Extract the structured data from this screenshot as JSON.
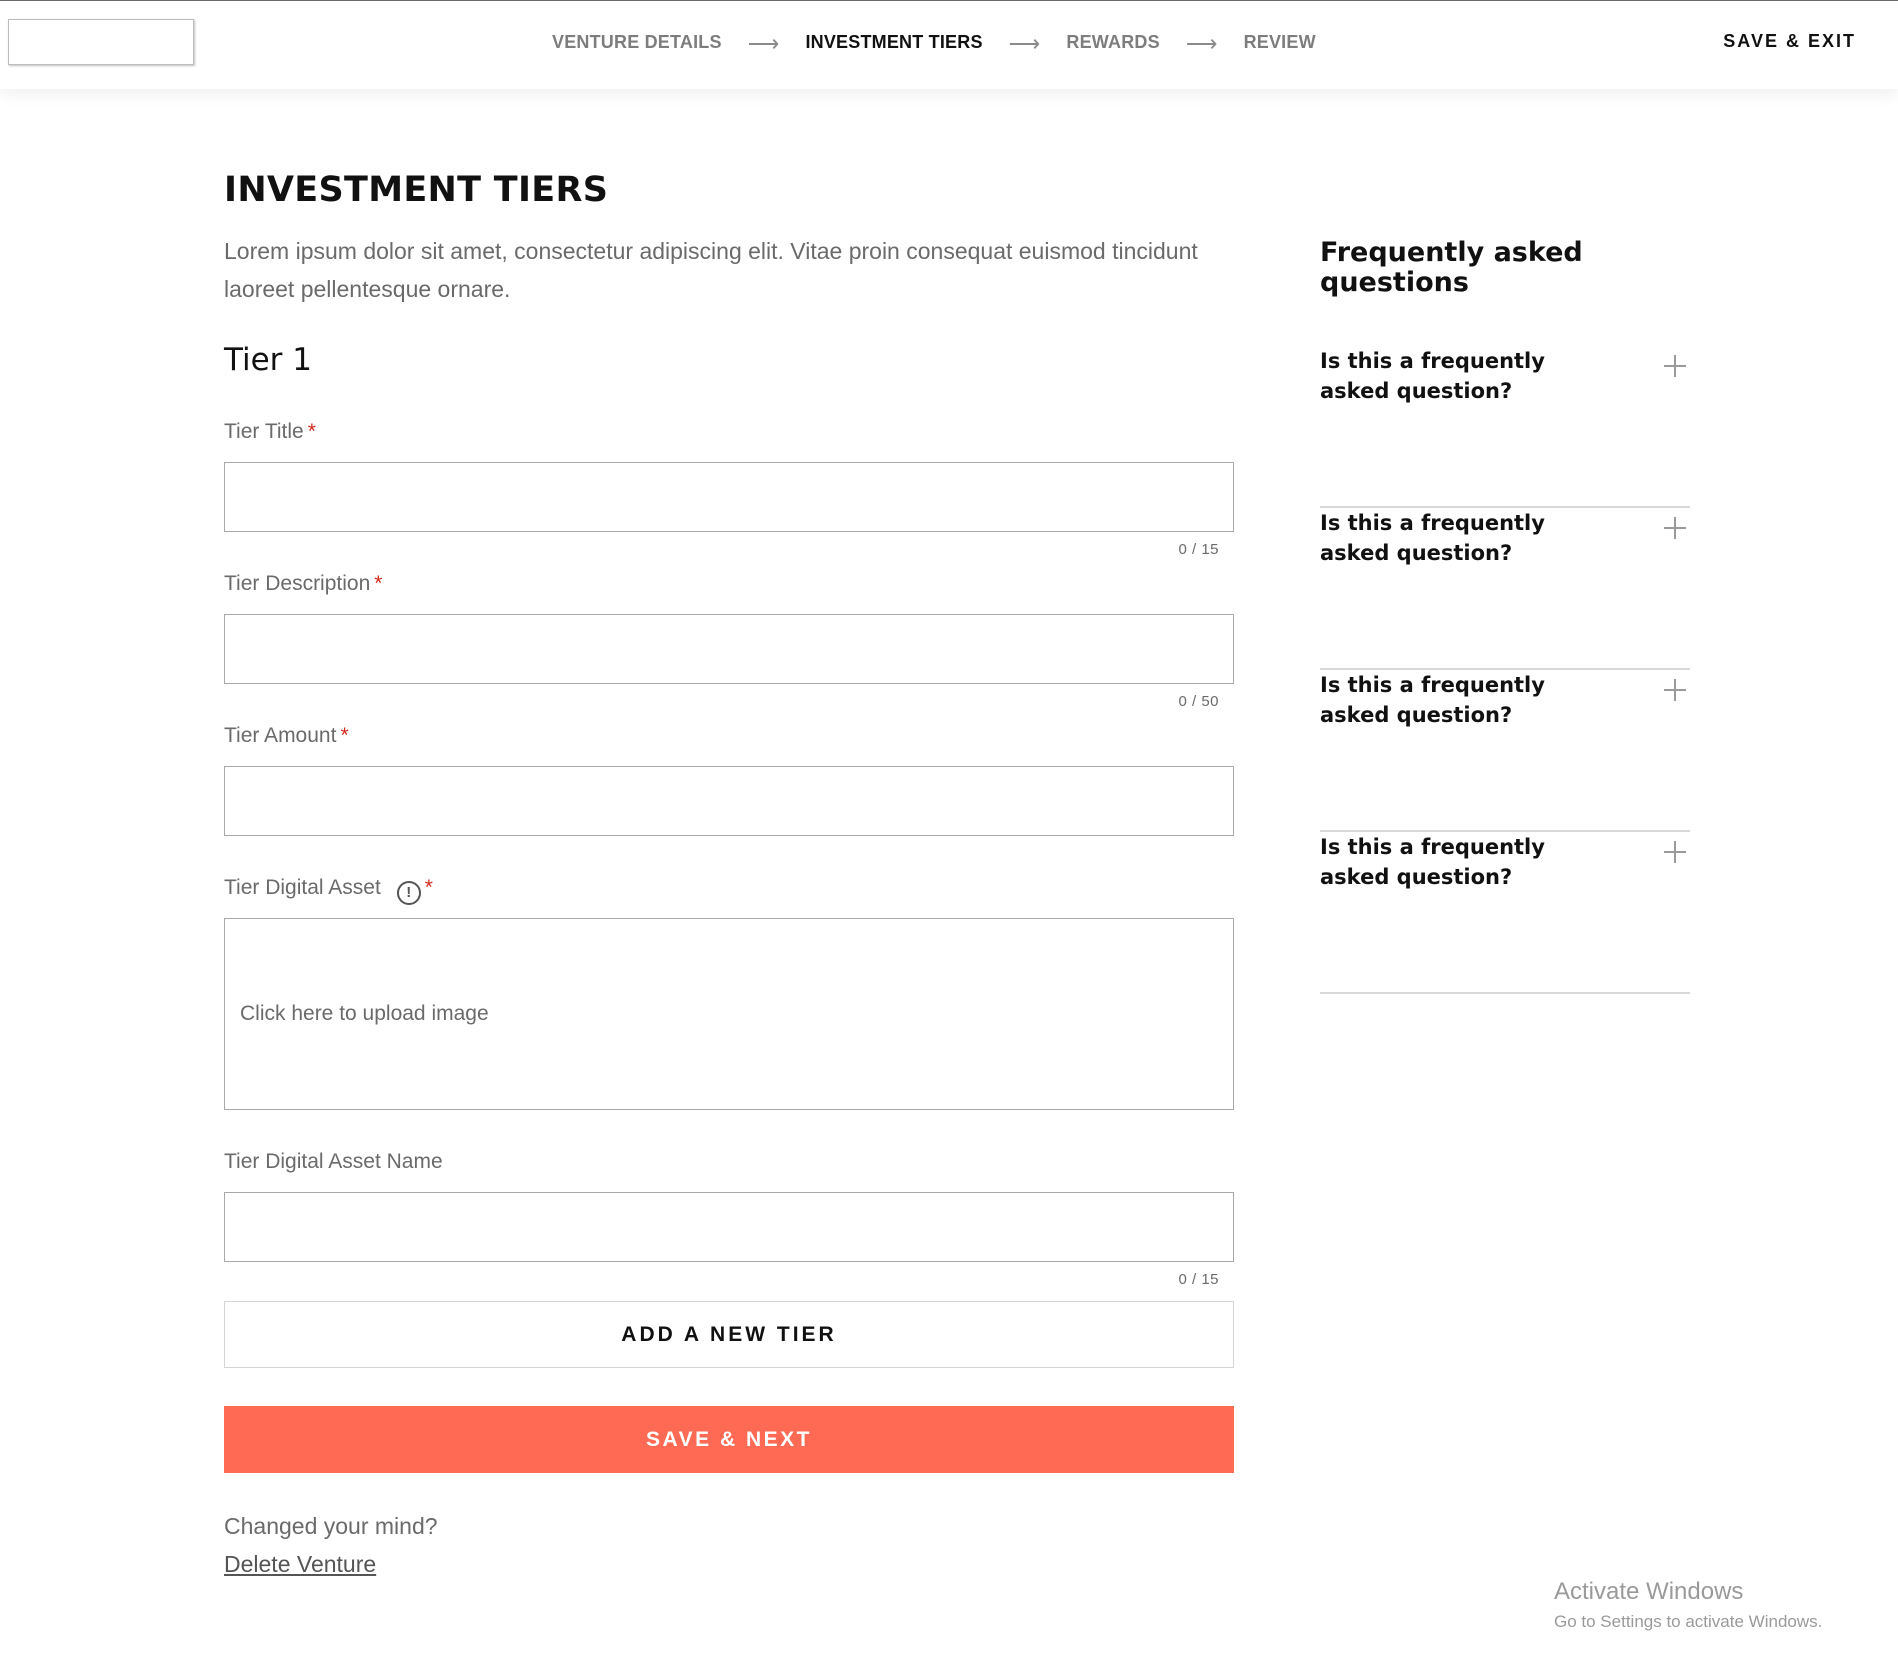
{
  "header": {
    "steps": [
      {
        "label": "VENTURE DETAILS",
        "active": false
      },
      {
        "label": "INVESTMENT TIERS",
        "active": true
      },
      {
        "label": "REWARDS",
        "active": false
      },
      {
        "label": "REVIEW",
        "active": false
      }
    ],
    "arrow": "⟶",
    "save_exit": "SAVE & EXIT"
  },
  "main": {
    "title": "INVESTMENT TIERS",
    "intro": "Lorem ipsum dolor sit amet, consectetur adipiscing elit. Vitae proin consequat euismod tincidunt laoreet pellentesque ornare.",
    "tier_heading": "Tier 1",
    "required_mark": "*",
    "fields": {
      "title": {
        "label": "Tier Title",
        "value": "",
        "counter": "0 / 15"
      },
      "description": {
        "label": "Tier Description",
        "value": "",
        "counter": "0 / 50"
      },
      "amount": {
        "label": "Tier Amount",
        "value": ""
      },
      "digital_asset": {
        "label": "Tier Digital Asset",
        "info_icon": "!",
        "upload_text": "Click here to upload image"
      },
      "asset_name": {
        "label": "Tier Digital Asset Name",
        "value": "",
        "counter": "0 / 15"
      }
    },
    "add_tier": "ADD A NEW TIER",
    "save_next": "SAVE & NEXT",
    "changed_mind": "Changed your mind?",
    "delete_venture": "Delete Venture"
  },
  "faq": {
    "title": "Frequently asked questions",
    "items": [
      {
        "question": "Is this a frequently asked question?"
      },
      {
        "question": "Is this a frequently asked question?"
      },
      {
        "question": "Is this a frequently asked question?"
      },
      {
        "question": "Is this a frequently asked question?"
      }
    ]
  },
  "watermark": {
    "title": "Activate Windows",
    "subtitle": "Go to Settings to activate Windows."
  },
  "colors": {
    "accent": "#ff6a55",
    "required": "#d42a1a",
    "muted_text": "#6a6a6a"
  }
}
